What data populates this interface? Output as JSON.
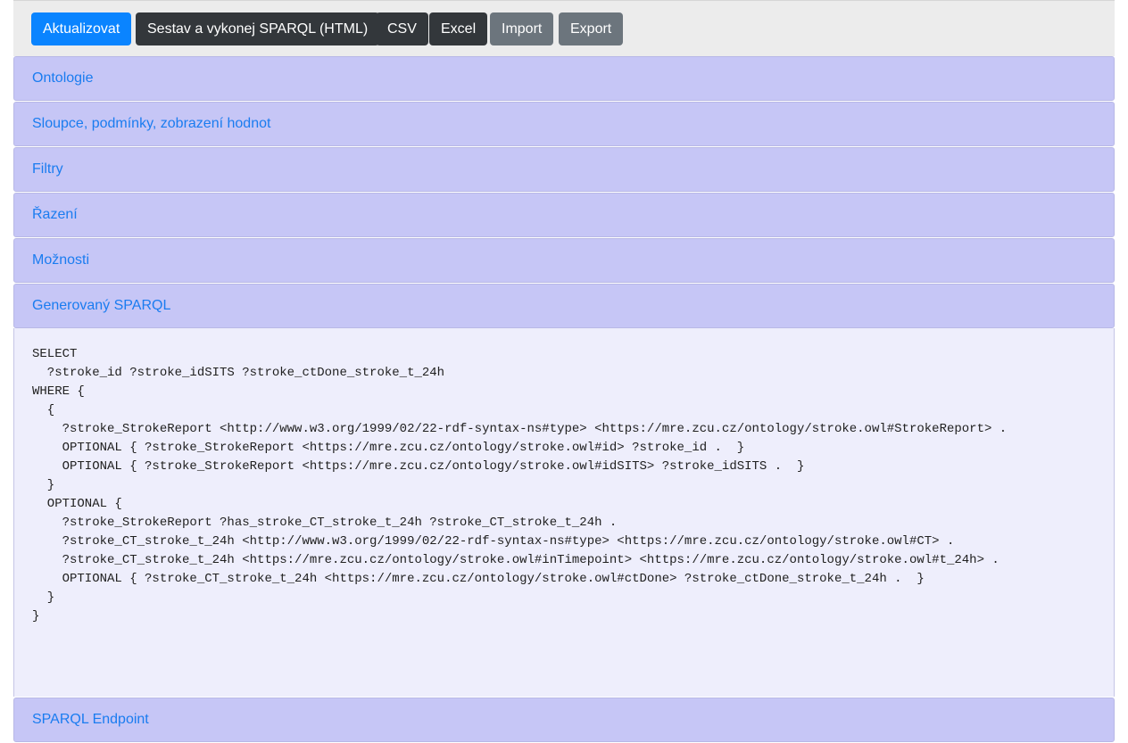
{
  "toolbar": {
    "update_label": "Aktualizovat",
    "build_run_label": "Sestav a vykonej SPARQL (HTML)",
    "csv_label": "CSV",
    "excel_label": "Excel",
    "import_label": "Import",
    "export_label": "Export"
  },
  "colors": {
    "primary": "#0a84ff",
    "dark": "#33373b",
    "secondary": "#6c757d",
    "panel_header_bg": "#c6c6f6",
    "panel_body_bg": "#eeeefc",
    "link": "#1a7cf0"
  },
  "panels": [
    {
      "label": "Ontologie",
      "expanded": false
    },
    {
      "label": "Sloupce, podmínky, zobrazení hodnot",
      "expanded": false
    },
    {
      "label": "Filtry",
      "expanded": false
    },
    {
      "label": "Řazení",
      "expanded": false
    },
    {
      "label": "Možnosti",
      "expanded": false
    },
    {
      "label": "Generovaný SPARQL",
      "expanded": true
    },
    {
      "label": "SPARQL Endpoint",
      "expanded": false
    }
  ],
  "generated_sparql": "SELECT\n  ?stroke_id ?stroke_idSITS ?stroke_ctDone_stroke_t_24h\nWHERE {\n  {\n    ?stroke_StrokeReport <http://www.w3.org/1999/02/22-rdf-syntax-ns#type> <https://mre.zcu.cz/ontology/stroke.owl#StrokeReport> .\n    OPTIONAL { ?stroke_StrokeReport <https://mre.zcu.cz/ontology/stroke.owl#id> ?stroke_id .  }\n    OPTIONAL { ?stroke_StrokeReport <https://mre.zcu.cz/ontology/stroke.owl#idSITS> ?stroke_idSITS .  }\n  }\n  OPTIONAL {\n    ?stroke_StrokeReport ?has_stroke_CT_stroke_t_24h ?stroke_CT_stroke_t_24h .\n    ?stroke_CT_stroke_t_24h <http://www.w3.org/1999/02/22-rdf-syntax-ns#type> <https://mre.zcu.cz/ontology/stroke.owl#CT> .\n    ?stroke_CT_stroke_t_24h <https://mre.zcu.cz/ontology/stroke.owl#inTimepoint> <https://mre.zcu.cz/ontology/stroke.owl#t_24h> .\n    OPTIONAL { ?stroke_CT_stroke_t_24h <https://mre.zcu.cz/ontology/stroke.owl#ctDone> ?stroke_ctDone_stroke_t_24h .  }\n  }\n}"
}
